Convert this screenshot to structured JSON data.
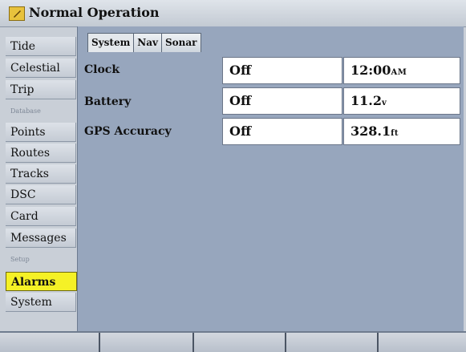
{
  "window": {
    "title": "Normal Operation",
    "icon": "folder-icon"
  },
  "nav": {
    "items": [
      {
        "label": "Tide",
        "type": "item"
      },
      {
        "label": "Celestial",
        "type": "item"
      },
      {
        "label": "Trip",
        "type": "item"
      },
      {
        "label": "Database",
        "type": "section"
      },
      {
        "label": "Points",
        "type": "item"
      },
      {
        "label": "Routes",
        "type": "item"
      },
      {
        "label": "Tracks",
        "type": "item"
      },
      {
        "label": "DSC",
        "type": "item"
      },
      {
        "label": "Card",
        "type": "item"
      },
      {
        "label": "Messages",
        "type": "item"
      },
      {
        "label": "Setup",
        "type": "section"
      },
      {
        "label": "Alarms",
        "type": "item",
        "selected": true
      },
      {
        "label": "System",
        "type": "item"
      }
    ]
  },
  "tabs": [
    {
      "label": "System",
      "active": true
    },
    {
      "label": "Nav",
      "active": false
    },
    {
      "label": "Sonar",
      "active": false
    }
  ],
  "alarms": [
    {
      "label": "Clock",
      "state": "Off",
      "value": "12:00",
      "unit": "AM"
    },
    {
      "label": "Battery",
      "state": "Off",
      "value": "11.2",
      "unit": "v"
    },
    {
      "label": "GPS Accuracy",
      "state": "Off",
      "value": "328.1",
      "unit": "ft"
    }
  ],
  "colors": {
    "selected_highlight": "#f5f126",
    "panel_background": "#97a6bd"
  },
  "softkeys": [
    "",
    "",
    "",
    "",
    ""
  ]
}
